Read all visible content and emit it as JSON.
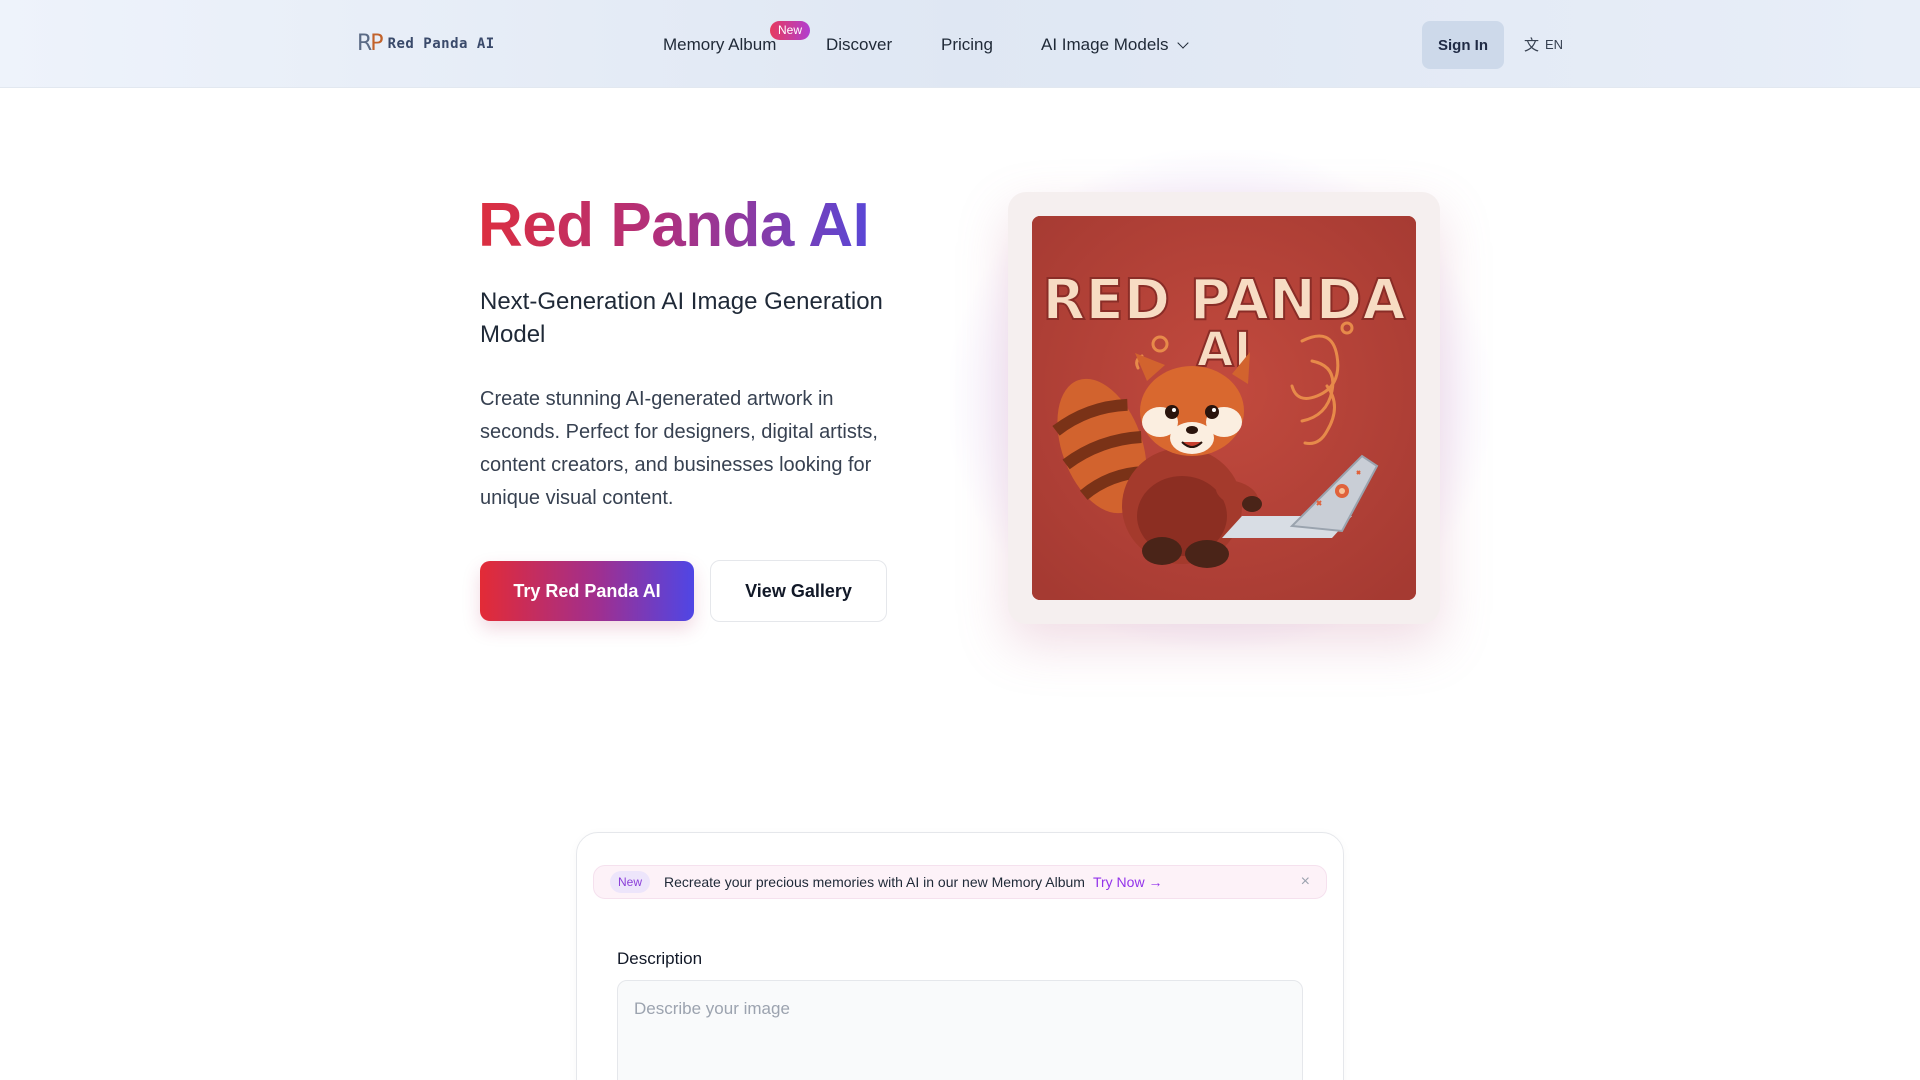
{
  "header": {
    "logo_mark_r": "R",
    "logo_mark_p": "P",
    "logo_text": "Red Panda AI",
    "nav": [
      {
        "label": "Memory Album",
        "badge": "New"
      },
      {
        "label": "Discover"
      },
      {
        "label": "Pricing"
      },
      {
        "label": "AI Image Models"
      }
    ],
    "signin_label": "Sign In",
    "language": "EN",
    "language_icon": "translate-icon"
  },
  "hero": {
    "title": "Red Panda AI",
    "subtitle": "Next-Generation AI Image Generation Model",
    "description": "Create stunning AI-generated artwork in seconds. Perfect for designers, digital artists, content creators, and businesses looking for unique visual content.",
    "primary_button": "Try Red Panda AI",
    "secondary_button": "View Gallery",
    "image_text_line1": "RED PANDA",
    "image_text_line2": "AI"
  },
  "generator": {
    "announce_badge": "New",
    "announce_text": "Recreate your precious memories with AI in our new Memory Album",
    "announce_link": "Try Now →",
    "close_icon": "×",
    "description_label": "Description",
    "description_placeholder": "Describe your image"
  },
  "colors": {
    "brand_red": "#dc2f3f",
    "brand_purple": "#5a47d6",
    "image_bg": "#b84238"
  }
}
